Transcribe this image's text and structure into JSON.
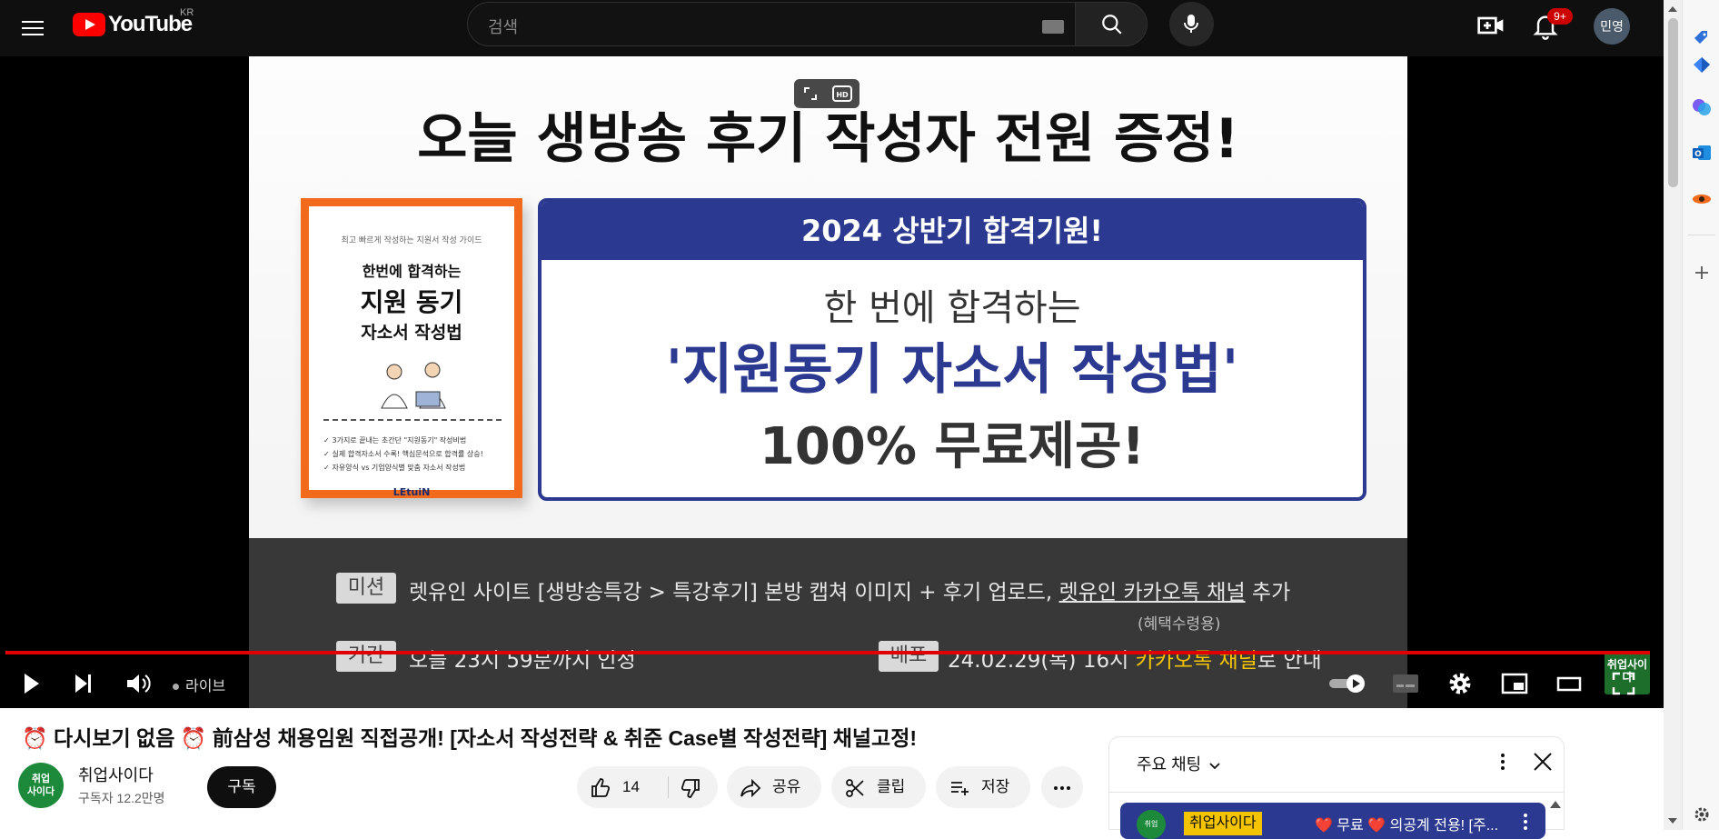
{
  "header": {
    "logo_text": "YouTube",
    "region": "KR",
    "search_placeholder": "검색",
    "notification_count": "9+",
    "avatar_initials": "민영"
  },
  "player": {
    "slide": {
      "title": "오늘 생방송 후기 작성자 전원 증정!",
      "book": {
        "small_caption": "최고 빠르게 작성하는 지원서 작성 가이드",
        "title_line1": "한번에 합격하는",
        "title_line2": "지원 동기",
        "title_line3": "자소서 작성법",
        "bullets": [
          "3가지로 끝내는 초간단 \"지원동기\" 작성비법",
          "실제 합격자소서 수록! 핵심문석으로 합격률 상승!",
          "자유양식 vs 기업양식별 맞춤 자소서 작성법"
        ],
        "brand": "LEtuiN"
      },
      "promo": {
        "header": "2024 상반기 합격기원!",
        "line1": "한 번에 합격하는",
        "line2": "'지원동기 자소서 작성법'",
        "line3": "100% 무료제공!"
      },
      "band": {
        "mission_tag": "미션",
        "mission_text_a": "렛유인 사이트 [생방송특강 > 특강후기] 본방 캡쳐 이미지 + 후기 업로드,",
        "mission_link": "렛유인 카카오톡 채널",
        "mission_text_b": "추가",
        "mission_note": "(혜택수령용)",
        "period_tag": "기간",
        "period_text": "오늘 23시 59분까지 인정",
        "delivery_tag": "배포",
        "delivery_text_a": "24.02.29(목) 16시",
        "delivery_highlight": "카카오톡 채널",
        "delivery_text_b": "로 안내"
      }
    },
    "watermark": "취업사이다",
    "live_label": "라이브",
    "progress_fraction": 1.0
  },
  "video": {
    "title": "⏰ 다시보기 없음 ⏰  前삼성 채용임원 직접공개! [자소서 작성전략 & 취준 Case별 작성전략] 채널고정!",
    "channel_name": "취업사이다",
    "subscribers": "구독자 12.2만명",
    "subscribe_label": "구독",
    "like_count": "14",
    "share_label": "공유",
    "clip_label": "클립",
    "save_label": "저장"
  },
  "chat": {
    "title": "주요 채팅",
    "pinned_author": "취업사이다",
    "pinned_message": "❤️ 무료 ❤️ 의공계 전용! [주..."
  },
  "colors": {
    "accent_red": "#ff0000",
    "progress_red": "#e00000",
    "promo_navy": "#2b3990",
    "book_orange": "#f26b1d",
    "highlight_yellow": "#f5c400"
  }
}
